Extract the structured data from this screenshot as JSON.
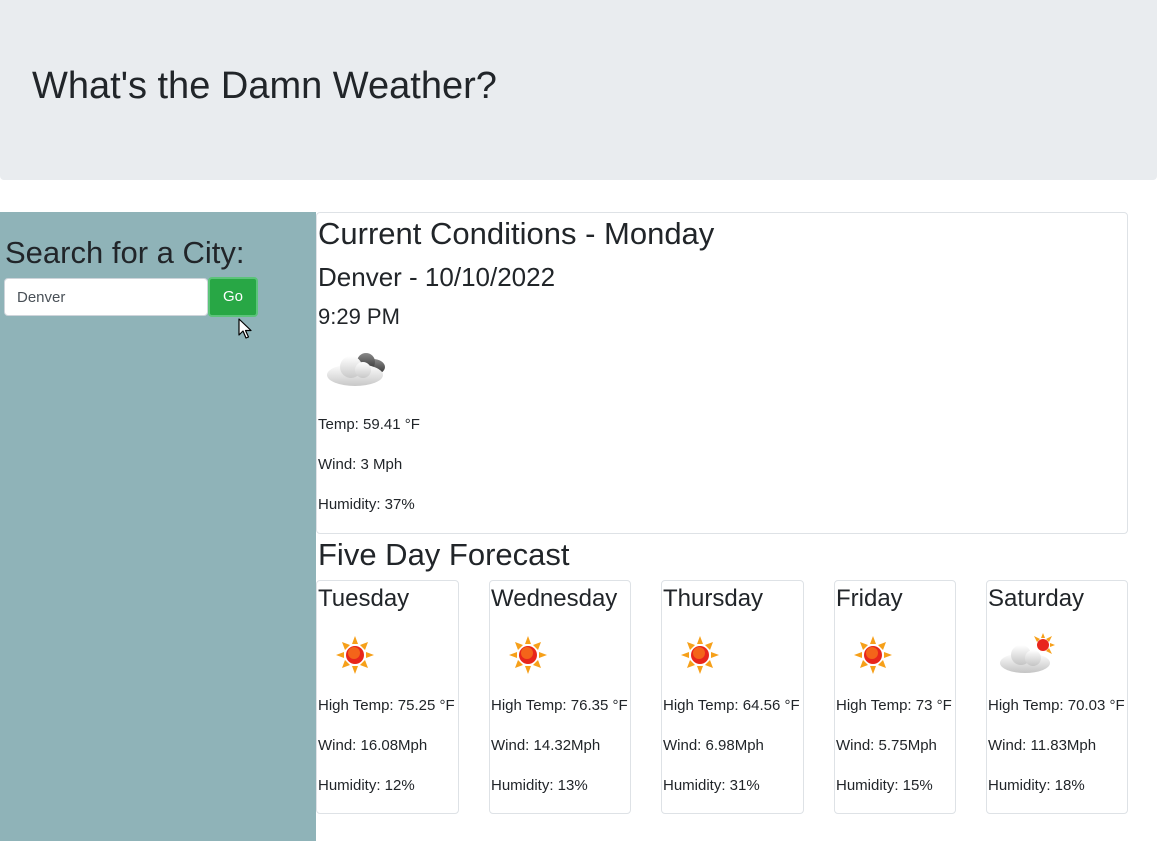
{
  "header": {
    "title": "What's the Damn Weather?"
  },
  "sidebar": {
    "heading": "Search for a City:",
    "search": {
      "value": "Denver",
      "placeholder": ""
    },
    "go_label": "Go"
  },
  "current": {
    "title": "Current Conditions - Monday",
    "city_date": "Denver - 10/10/2022",
    "time": "9:29 PM",
    "icon": "partly-cloudy-night-icon",
    "temp": "Temp: 59.41 °F",
    "wind": "Wind: 3 Mph",
    "humidity": "Humidity: 37%"
  },
  "forecast": {
    "title": "Five Day Forecast",
    "days": [
      {
        "day": "Tuesday",
        "icon": "sun-icon",
        "high": "High Temp: 75.25 °F",
        "wind": "Wind: 16.08Mph",
        "humidity": "Humidity: 12%"
      },
      {
        "day": "Wednesday",
        "icon": "sun-icon",
        "high": "High Temp: 76.35 °F",
        "wind": "Wind: 14.32Mph",
        "humidity": "Humidity: 13%"
      },
      {
        "day": "Thursday",
        "icon": "sun-icon",
        "high": "High Temp: 64.56 °F",
        "wind": "Wind: 6.98Mph",
        "humidity": "Humidity: 31%"
      },
      {
        "day": "Friday",
        "icon": "sun-icon",
        "high": "High Temp: 73 °F",
        "wind": "Wind: 5.75Mph",
        "humidity": "Humidity: 15%"
      },
      {
        "day": "Saturday",
        "icon": "partly-cloudy-day-icon",
        "high": "High Temp: 70.03 °F",
        "wind": "Wind: 11.83Mph",
        "humidity": "Humidity: 18%"
      }
    ]
  },
  "colors": {
    "header_bg": "#e9ecef",
    "sidebar_bg": "#8fb3b8",
    "go_button": "#28a745"
  }
}
